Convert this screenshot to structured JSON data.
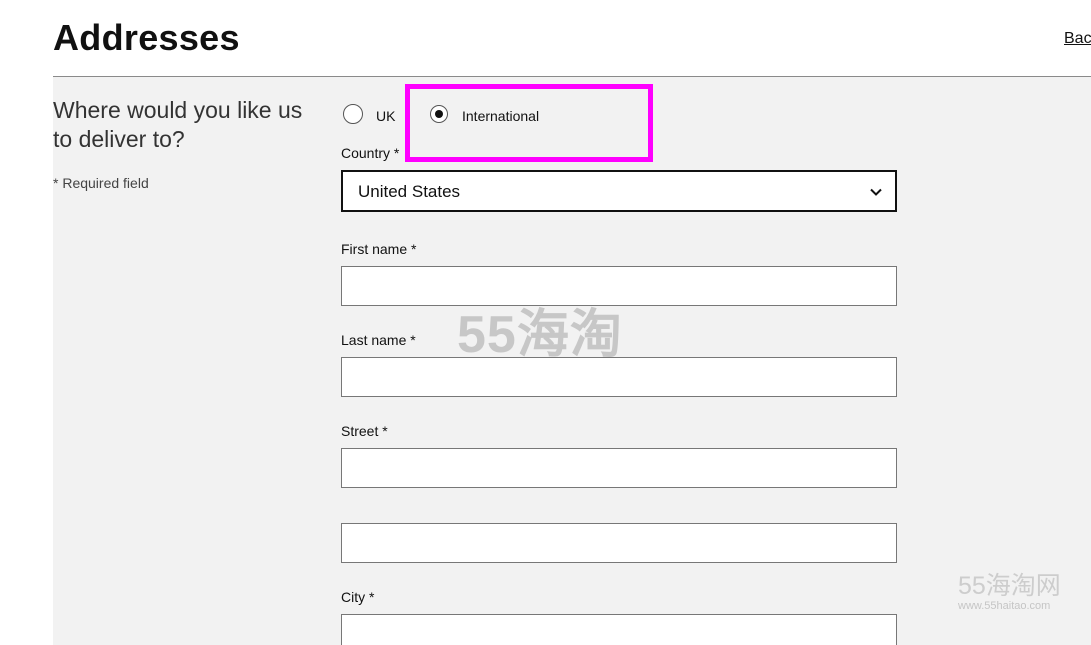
{
  "header": {
    "title": "Addresses",
    "back_label": "Bac"
  },
  "intro": {
    "heading": "Where would you like us to deliver to?",
    "required_note": "* Required field"
  },
  "delivery_options": {
    "uk_label": "UK",
    "international_label": "International",
    "selected": "International"
  },
  "form": {
    "country": {
      "label": "Country *",
      "value": "United States"
    },
    "first_name": {
      "label": "First name *",
      "value": ""
    },
    "last_name": {
      "label": "Last name *",
      "value": ""
    },
    "street": {
      "label": "Street *",
      "value": ""
    },
    "street_line2": {
      "value": ""
    },
    "city": {
      "label": "City *",
      "value": ""
    }
  },
  "watermark": {
    "center_text": "55海淘",
    "corner_text": "55海淘网",
    "corner_url": "www.55haitao.com"
  },
  "colors": {
    "highlight": "#ff00ff",
    "panel_bg": "#f2f2f2"
  }
}
